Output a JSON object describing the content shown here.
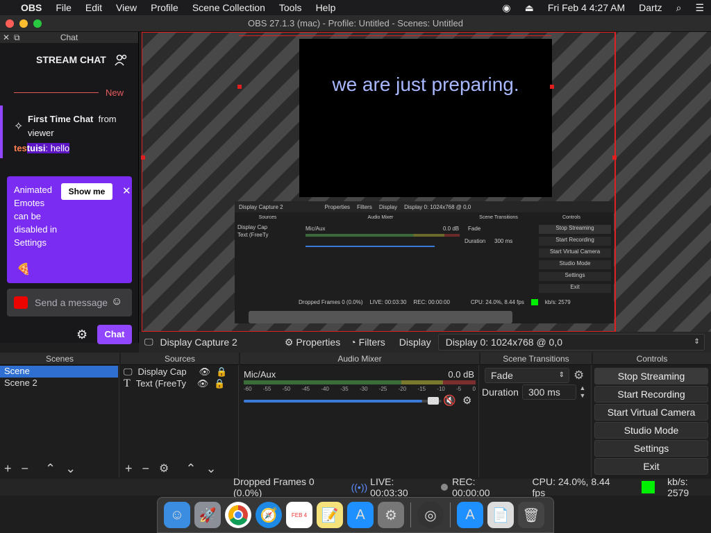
{
  "menubar": {
    "apple": "",
    "app": "OBS",
    "items": [
      "File",
      "Edit",
      "View",
      "Profile",
      "Scene Collection",
      "Tools",
      "Help"
    ],
    "datetime": "Fri Feb 4  4:27 AM",
    "user": "Dartz"
  },
  "window": {
    "title": "OBS 27.1.3 (mac) - Profile: Untitled - Scenes: Untitled"
  },
  "chat": {
    "dock_title": "Chat",
    "header": "STREAM CHAT",
    "new_label": "New",
    "first_time_title": "First Time Chat",
    "first_time_from": "from",
    "first_time_user": "viewer",
    "msg_user_a": "tes",
    "msg_user_b": "tuisi",
    "msg_text": ": hello",
    "promo_text": "Animated Emotes can be disabled in Settings",
    "promo_button": "Show me",
    "input_placeholder": "Send a message",
    "chat_button": "Chat"
  },
  "preview": {
    "text": "we are just preparing."
  },
  "nested": {
    "capture": "Display Capture 2",
    "properties": "Properties",
    "filters": "Filters",
    "display": "Display",
    "display_value": "Display 0: 1024x768 @ 0,0",
    "sources": "Sources",
    "audio_mixer": "Audio Mixer",
    "scene_transitions": "Scene Transitions",
    "controls": "Controls",
    "src1": "Display Cap",
    "src2": "Text (FreeTy",
    "mic": "Mic/Aux",
    "db": "0.0 dB",
    "fade": "Fade",
    "duration": "Duration",
    "duration_val": "300 ms",
    "stop": "Stop Streaming",
    "rec": "Start Recording",
    "vcam": "Start Virtual Camera",
    "studio": "Studio Mode",
    "settings": "Settings",
    "exit": "Exit",
    "dropped": "Dropped Frames 0 (0.0%)",
    "live": "LIVE: 00:03:30",
    "recstat": "REC: 00:00:00",
    "cpu": "CPU: 24.0%, 8.44 fps",
    "kbs": "kb/s: 2579"
  },
  "toolbar": {
    "source": "Display Capture 2",
    "properties": "Properties",
    "filters": "Filters",
    "display_label": "Display",
    "display_value": "Display 0: 1024x768 @ 0,0"
  },
  "scenes": {
    "title": "Scenes",
    "items": [
      "Scene",
      "Scene 2"
    ]
  },
  "sources": {
    "title": "Sources",
    "items": [
      "Display Cap",
      "Text (FreeTy"
    ]
  },
  "mixer": {
    "title": "Audio Mixer",
    "channel": "Mic/Aux",
    "db": "0.0 dB",
    "scale": [
      "-60",
      "-55",
      "-50",
      "-45",
      "-40",
      "-35",
      "-30",
      "-25",
      "-20",
      "-15",
      "-10",
      "-5",
      "0"
    ],
    "volume": 0.9
  },
  "transitions": {
    "title": "Scene Transitions",
    "selected": "Fade",
    "duration_label": "Duration",
    "duration_value": "300 ms"
  },
  "controls": {
    "title": "Controls",
    "stop_streaming": "Stop Streaming",
    "start_recording": "Start Recording",
    "start_virtual_camera": "Start Virtual Camera",
    "studio_mode": "Studio Mode",
    "settings": "Settings",
    "exit": "Exit"
  },
  "status": {
    "dropped": "Dropped Frames 0 (0.0%)",
    "live": "LIVE: 00:03:30",
    "rec": "REC: 00:00:00",
    "cpu": "CPU: 24.0%, 8.44 fps",
    "kbs": "kb/s: 2579"
  },
  "dock_cal": "FEB 4",
  "colors": {
    "accent": "#9147ff",
    "selection": "#2f6fd1",
    "live_green": "#00ee00",
    "muted_red": "#e0383e"
  }
}
